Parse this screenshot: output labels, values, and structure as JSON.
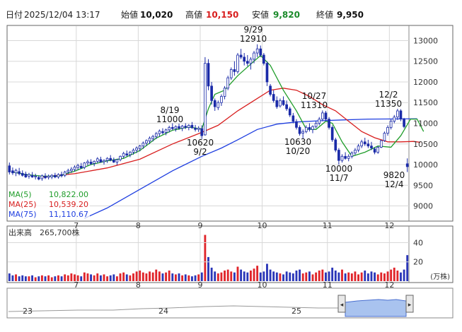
{
  "header": {
    "date_label": "日付",
    "datetime": "2025/12/04 13:17",
    "open_label": "始値",
    "open": "10,020",
    "high_label": "高値",
    "high": "10,150",
    "low_label": "安値",
    "low": "9,820",
    "close_label": "終値",
    "close": "9,950"
  },
  "colors": {
    "up": "#ffffff",
    "down": "#1a2aa8",
    "ma5": "#1f9d2a",
    "ma25": "#d81e1e",
    "ma75": "#1e3ee0",
    "vol_up": "#e0242a",
    "vol_down": "#2a36b8",
    "grid": "#d8d8d8",
    "nav_fill": "#a9c3ef"
  },
  "ma_legend": [
    {
      "name": "MA(5)",
      "value": "10,822.00",
      "color": "#1f9d2a"
    },
    {
      "name": "MA(25)",
      "value": "10,539.20",
      "color": "#d81e1e"
    },
    {
      "name": "MA(75)",
      "value": "11,110.67",
      "color": "#1e3ee0"
    }
  ],
  "annotations": [
    {
      "date": "8/19",
      "value": "11000"
    },
    {
      "date": "9/2",
      "value": "10620"
    },
    {
      "date": "9/29",
      "value": "12910"
    },
    {
      "date": "10/20",
      "value": "10630"
    },
    {
      "date": "10/27",
      "value": "11310"
    },
    {
      "date": "11/7",
      "value": "10000"
    },
    {
      "date": "12/2",
      "value": "11350"
    },
    {
      "date": "12/4",
      "value": "9820"
    }
  ],
  "volume": {
    "title": "出来高",
    "current": "265,700株",
    "unit": "(万株)",
    "ticks": [
      20,
      40
    ]
  },
  "nav": {
    "labels": [
      "23",
      "24",
      "25"
    ]
  },
  "chart_data": {
    "type": "candlestick",
    "price_ticks": [
      9000,
      9500,
      10000,
      10500,
      11000,
      11500,
      12000,
      12500,
      13000
    ],
    "ylim": [
      8650,
      13350
    ],
    "month_labels": [
      "7",
      "8",
      "9",
      "10",
      "11",
      "12"
    ],
    "month_start_index": [
      21,
      40,
      59,
      78,
      98,
      117
    ],
    "candles": [
      [
        9970,
        10050,
        9760,
        9820
      ],
      [
        9850,
        9930,
        9750,
        9800
      ],
      [
        9800,
        9900,
        9720,
        9860
      ],
      [
        9830,
        9920,
        9740,
        9780
      ],
      [
        9790,
        9860,
        9710,
        9740
      ],
      [
        9770,
        9830,
        9680,
        9700
      ],
      [
        9720,
        9800,
        9660,
        9760
      ],
      [
        9740,
        9820,
        9680,
        9700
      ],
      [
        9700,
        9780,
        9640,
        9720
      ],
      [
        9690,
        9740,
        9620,
        9650
      ],
      [
        9660,
        9760,
        9610,
        9730
      ],
      [
        9720,
        9790,
        9650,
        9680
      ],
      [
        9690,
        9760,
        9640,
        9720
      ],
      [
        9700,
        9770,
        9650,
        9740
      ],
      [
        9740,
        9800,
        9670,
        9700
      ],
      [
        9700,
        9790,
        9660,
        9760
      ],
      [
        9760,
        9830,
        9690,
        9730
      ],
      [
        9740,
        9850,
        9700,
        9820
      ],
      [
        9820,
        9900,
        9760,
        9860
      ],
      [
        9850,
        9940,
        9800,
        9890
      ],
      [
        9880,
        9980,
        9830,
        9940
      ],
      [
        9930,
        10020,
        9870,
        9980
      ],
      [
        9960,
        10040,
        9900,
        9920
      ],
      [
        9930,
        10060,
        9890,
        10040
      ],
      [
        10040,
        10120,
        9980,
        10070
      ],
      [
        10060,
        10130,
        9990,
        10020
      ],
      [
        10030,
        10100,
        9960,
        10080
      ],
      [
        10080,
        10180,
        10030,
        10140
      ],
      [
        10120,
        10190,
        10050,
        10060
      ],
      [
        10070,
        10130,
        10000,
        10100
      ],
      [
        10100,
        10180,
        10040,
        10150
      ],
      [
        10150,
        10230,
        10080,
        10110
      ],
      [
        10110,
        10170,
        10040,
        10060
      ],
      [
        10060,
        10140,
        9990,
        10120
      ],
      [
        10120,
        10220,
        10080,
        10200
      ],
      [
        10200,
        10310,
        10150,
        10270
      ],
      [
        10260,
        10340,
        10190,
        10230
      ],
      [
        10240,
        10330,
        10180,
        10300
      ],
      [
        10300,
        10390,
        10240,
        10350
      ],
      [
        10350,
        10440,
        10280,
        10400
      ],
      [
        10390,
        10480,
        10320,
        10450
      ],
      [
        10450,
        10560,
        10380,
        10520
      ],
      [
        10520,
        10610,
        10450,
        10580
      ],
      [
        10570,
        10680,
        10500,
        10640
      ],
      [
        10630,
        10720,
        10560,
        10680
      ],
      [
        10680,
        10790,
        10620,
        10750
      ],
      [
        10750,
        10850,
        10680,
        10810
      ],
      [
        10800,
        10880,
        10730,
        10770
      ],
      [
        10780,
        10870,
        10710,
        10840
      ],
      [
        10840,
        10940,
        10780,
        10900
      ],
      [
        10900,
        11000,
        10830,
        10870
      ],
      [
        10870,
        10950,
        10800,
        10920
      ],
      [
        10920,
        10990,
        10840,
        10880
      ],
      [
        10880,
        10960,
        10810,
        10930
      ],
      [
        10930,
        11000,
        10860,
        10900
      ],
      [
        10900,
        10980,
        10830,
        10950
      ],
      [
        10950,
        11030,
        10870,
        10890
      ],
      [
        10880,
        10960,
        10800,
        10850
      ],
      [
        10850,
        10930,
        10790,
        10880
      ],
      [
        10870,
        10950,
        10620,
        10700
      ],
      [
        10720,
        12600,
        10700,
        12450
      ],
      [
        12450,
        12550,
        11800,
        11900
      ],
      [
        11900,
        12000,
        11450,
        11550
      ],
      [
        11550,
        11600,
        11300,
        11400
      ],
      [
        11380,
        11550,
        11320,
        11500
      ],
      [
        11500,
        11700,
        11420,
        11650
      ],
      [
        11650,
        11900,
        11580,
        11850
      ],
      [
        11850,
        12150,
        11800,
        12100
      ],
      [
        12100,
        12350,
        12050,
        12300
      ],
      [
        12300,
        12500,
        12150,
        12250
      ],
      [
        12250,
        12700,
        12200,
        12650
      ],
      [
        12650,
        12800,
        12550,
        12600
      ],
      [
        12600,
        12700,
        12400,
        12500
      ],
      [
        12500,
        12650,
        12380,
        12450
      ],
      [
        12450,
        12600,
        12300,
        12550
      ],
      [
        12550,
        12750,
        12450,
        12700
      ],
      [
        12700,
        12910,
        12600,
        12800
      ],
      [
        12800,
        12880,
        12600,
        12650
      ],
      [
        12650,
        12700,
        12400,
        12450
      ],
      [
        12450,
        12500,
        11900,
        12000
      ],
      [
        11900,
        11950,
        11650,
        11700
      ],
      [
        11700,
        11800,
        11500,
        11550
      ],
      [
        11550,
        11650,
        11350,
        11400
      ],
      [
        11420,
        11600,
        11380,
        11550
      ],
      [
        11550,
        11650,
        11420,
        11450
      ],
      [
        11450,
        11550,
        11300,
        11350
      ],
      [
        11350,
        11400,
        11150,
        11200
      ],
      [
        11180,
        11250,
        11000,
        11050
      ],
      [
        11040,
        11100,
        10850,
        10900
      ],
      [
        10900,
        10950,
        10700,
        10750
      ],
      [
        10760,
        10850,
        10630,
        10800
      ],
      [
        10800,
        10950,
        10760,
        10900
      ],
      [
        10900,
        11000,
        10800,
        10850
      ],
      [
        10850,
        10950,
        10760,
        10920
      ],
      [
        10920,
        11050,
        10880,
        11000
      ],
      [
        11000,
        11150,
        10950,
        11100
      ],
      [
        11100,
        11310,
        11050,
        11250
      ],
      [
        11250,
        11300,
        11050,
        11100
      ],
      [
        11100,
        11150,
        10850,
        10900
      ],
      [
        10900,
        10950,
        10550,
        10600
      ],
      [
        10600,
        10650,
        10300,
        10350
      ],
      [
        10350,
        10400,
        10000,
        10100
      ],
      [
        10100,
        10250,
        10050,
        10200
      ],
      [
        10200,
        10300,
        10120,
        10150
      ],
      [
        10150,
        10250,
        10080,
        10200
      ],
      [
        10200,
        10320,
        10150,
        10280
      ],
      [
        10280,
        10400,
        10230,
        10350
      ],
      [
        10350,
        10500,
        10300,
        10450
      ],
      [
        10450,
        10600,
        10400,
        10550
      ],
      [
        10550,
        10650,
        10450,
        10500
      ],
      [
        10500,
        10600,
        10400,
        10450
      ],
      [
        10450,
        10550,
        10350,
        10400
      ],
      [
        10380,
        10420,
        10250,
        10300
      ],
      [
        10300,
        10450,
        10260,
        10420
      ],
      [
        10420,
        10600,
        10400,
        10580
      ],
      [
        10580,
        10800,
        10550,
        10760
      ],
      [
        10760,
        10950,
        10700,
        10900
      ],
      [
        10900,
        11100,
        10850,
        11050
      ],
      [
        11050,
        11200,
        11000,
        11150
      ],
      [
        11150,
        11350,
        11080,
        11300
      ],
      [
        11300,
        11340,
        11050,
        11100
      ],
      [
        11100,
        11130,
        10880,
        10920
      ],
      [
        10020,
        10150,
        9820,
        9950
      ]
    ],
    "ma5": [
      [
        1,
        9820
      ],
      [
        5,
        9760
      ],
      [
        10,
        9720
      ],
      [
        15,
        9720
      ],
      [
        20,
        9840
      ],
      [
        25,
        10000
      ],
      [
        30,
        10090
      ],
      [
        35,
        10150
      ],
      [
        40,
        10340
      ],
      [
        45,
        10640
      ],
      [
        50,
        10830
      ],
      [
        55,
        10910
      ],
      [
        59,
        10860
      ],
      [
        61,
        11350
      ],
      [
        63,
        11700
      ],
      [
        66,
        11800
      ],
      [
        70,
        12150
      ],
      [
        75,
        12500
      ],
      [
        77,
        12640
      ],
      [
        80,
        12400
      ],
      [
        84,
        11800
      ],
      [
        88,
        11300
      ],
      [
        91,
        10860
      ],
      [
        94,
        10850
      ],
      [
        97,
        11050
      ],
      [
        99,
        11000
      ],
      [
        102,
        10550
      ],
      [
        105,
        10200
      ],
      [
        109,
        10300
      ],
      [
        113,
        10450
      ],
      [
        117,
        10420
      ],
      [
        120,
        10700
      ],
      [
        123,
        11100
      ],
      [
        125,
        11100
      ],
      [
        127,
        10800
      ]
    ],
    "ma25": [
      [
        10,
        9700
      ],
      [
        20,
        9780
      ],
      [
        30,
        9920
      ],
      [
        40,
        10130
      ],
      [
        50,
        10500
      ],
      [
        59,
        10780
      ],
      [
        64,
        10950
      ],
      [
        70,
        11300
      ],
      [
        76,
        11600
      ],
      [
        80,
        11800
      ],
      [
        84,
        11850
      ],
      [
        88,
        11800
      ],
      [
        92,
        11650
      ],
      [
        96,
        11450
      ],
      [
        100,
        11300
      ],
      [
        104,
        11050
      ],
      [
        108,
        10800
      ],
      [
        112,
        10650
      ],
      [
        116,
        10550
      ],
      [
        120,
        10550
      ],
      [
        124,
        10560
      ],
      [
        126,
        10539
      ]
    ],
    "ma75": [
      [
        23,
        8700
      ],
      [
        30,
        8950
      ],
      [
        40,
        9400
      ],
      [
        50,
        9850
      ],
      [
        59,
        10200
      ],
      [
        65,
        10400
      ],
      [
        70,
        10600
      ],
      [
        76,
        10850
      ],
      [
        82,
        10980
      ],
      [
        88,
        11030
      ],
      [
        95,
        11060
      ],
      [
        102,
        11080
      ],
      [
        110,
        11100
      ],
      [
        118,
        11105
      ],
      [
        125,
        11110
      ]
    ],
    "volume": [
      8,
      6,
      7,
      5,
      6,
      5,
      5,
      6,
      4,
      5,
      6,
      5,
      6,
      4,
      5,
      6,
      5,
      7,
      6,
      8,
      7,
      6,
      5,
      9,
      8,
      7,
      6,
      8,
      6,
      7,
      5,
      6,
      7,
      5,
      8,
      9,
      7,
      6,
      8,
      10,
      11,
      9,
      8,
      10,
      9,
      12,
      10,
      8,
      9,
      11,
      8,
      7,
      8,
      6,
      7,
      6,
      5,
      6,
      7,
      9,
      48,
      25,
      14,
      10,
      8,
      9,
      11,
      12,
      10,
      9,
      15,
      12,
      10,
      9,
      11,
      13,
      16,
      9,
      10,
      18,
      12,
      10,
      9,
      8,
      7,
      10,
      9,
      8,
      11,
      12,
      8,
      9,
      10,
      7,
      9,
      11,
      12,
      9,
      10,
      14,
      11,
      9,
      12,
      8,
      9,
      8,
      10,
      7,
      9,
      11,
      8,
      10,
      9,
      7,
      9,
      8,
      10,
      12,
      14,
      11,
      9,
      12,
      27
    ]
  }
}
